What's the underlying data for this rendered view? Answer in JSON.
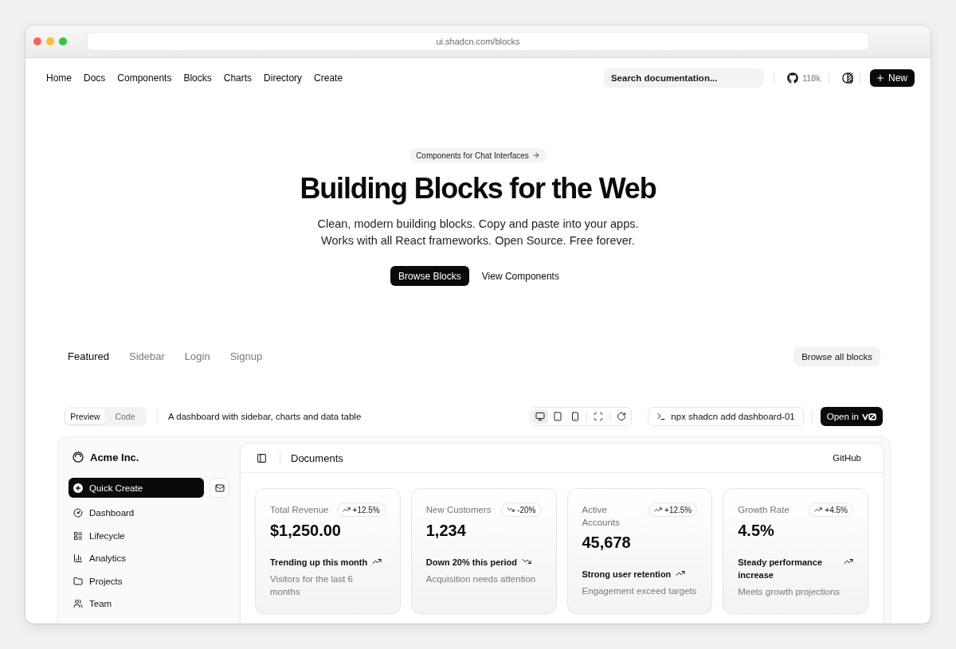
{
  "browser": {
    "url": "ui.shadcn.com/blocks"
  },
  "nav": {
    "links": [
      {
        "label": "Home"
      },
      {
        "label": "Docs"
      },
      {
        "label": "Components"
      },
      {
        "label": "Blocks"
      },
      {
        "label": "Charts"
      },
      {
        "label": "Directory"
      },
      {
        "label": "Create"
      }
    ],
    "search": {
      "placeholder": "Search documentation..."
    },
    "github_stars": "118k",
    "new_button": "New"
  },
  "hero": {
    "announcement": "Components for Chat Interfaces",
    "title": "Building Blocks for the Web",
    "subtitle": "Clean, modern building blocks. Copy and paste into your apps. Works with all React frameworks. Open Source. Free forever.",
    "buttons": [
      {
        "label": "Browse Blocks",
        "kind": "primary"
      },
      {
        "label": "View Components",
        "kind": "ghost"
      }
    ]
  },
  "block_tabs": [
    {
      "label": "Featured",
      "selected": true
    },
    {
      "label": "Sidebar",
      "selected": false
    },
    {
      "label": "Login",
      "selected": false
    },
    {
      "label": "Signup",
      "selected": false
    }
  ],
  "browse_all_button": "Browse all blocks",
  "block_toolbar": {
    "view_tabs": [
      {
        "label": "Preview",
        "selected": true
      },
      {
        "label": "Code",
        "selected": false
      }
    ],
    "description": "A dashboard with sidebar, charts and data table",
    "devices": [
      {
        "kind": "desktop",
        "selected": true
      },
      {
        "kind": "tablet",
        "selected": false
      },
      {
        "kind": "phone",
        "selected": false
      }
    ],
    "command": "npx shadcn add dashboard-01",
    "open_in_button": "Open in"
  },
  "preview": {
    "sidebar": {
      "brand": "Acme Inc.",
      "quick_create": "Quick Create",
      "items": [
        {
          "label": "Dashboard",
          "kind": "dashboard"
        },
        {
          "label": "Lifecycle",
          "kind": "lifecycle"
        },
        {
          "label": "Analytics",
          "kind": "analytics"
        },
        {
          "label": "Projects",
          "kind": "projects"
        },
        {
          "label": "Team",
          "kind": "team"
        }
      ]
    },
    "header": {
      "title": "Documents",
      "link": "GitHub"
    },
    "cards": [
      {
        "kind": "up",
        "label": "Total Revenue",
        "change": "+12.5%",
        "value": "$1,250.00",
        "summary": "Trending up this month",
        "description": "Visitors for the last 6 months"
      },
      {
        "kind": "down",
        "label": "New Customers",
        "change": "-20%",
        "value": "1,234",
        "summary": "Down 20% this period",
        "description": "Acquisition needs attention"
      },
      {
        "kind": "up",
        "label": "Active Accounts",
        "change": "+12.5%",
        "value": "45,678",
        "summary": "Strong user retention",
        "description": "Engagement exceed targets"
      },
      {
        "kind": "up",
        "label": "Growth Rate",
        "change": "+4.5%",
        "value": "4.5%",
        "summary": "Steady performance increase",
        "description": "Meets growth projections"
      }
    ]
  }
}
